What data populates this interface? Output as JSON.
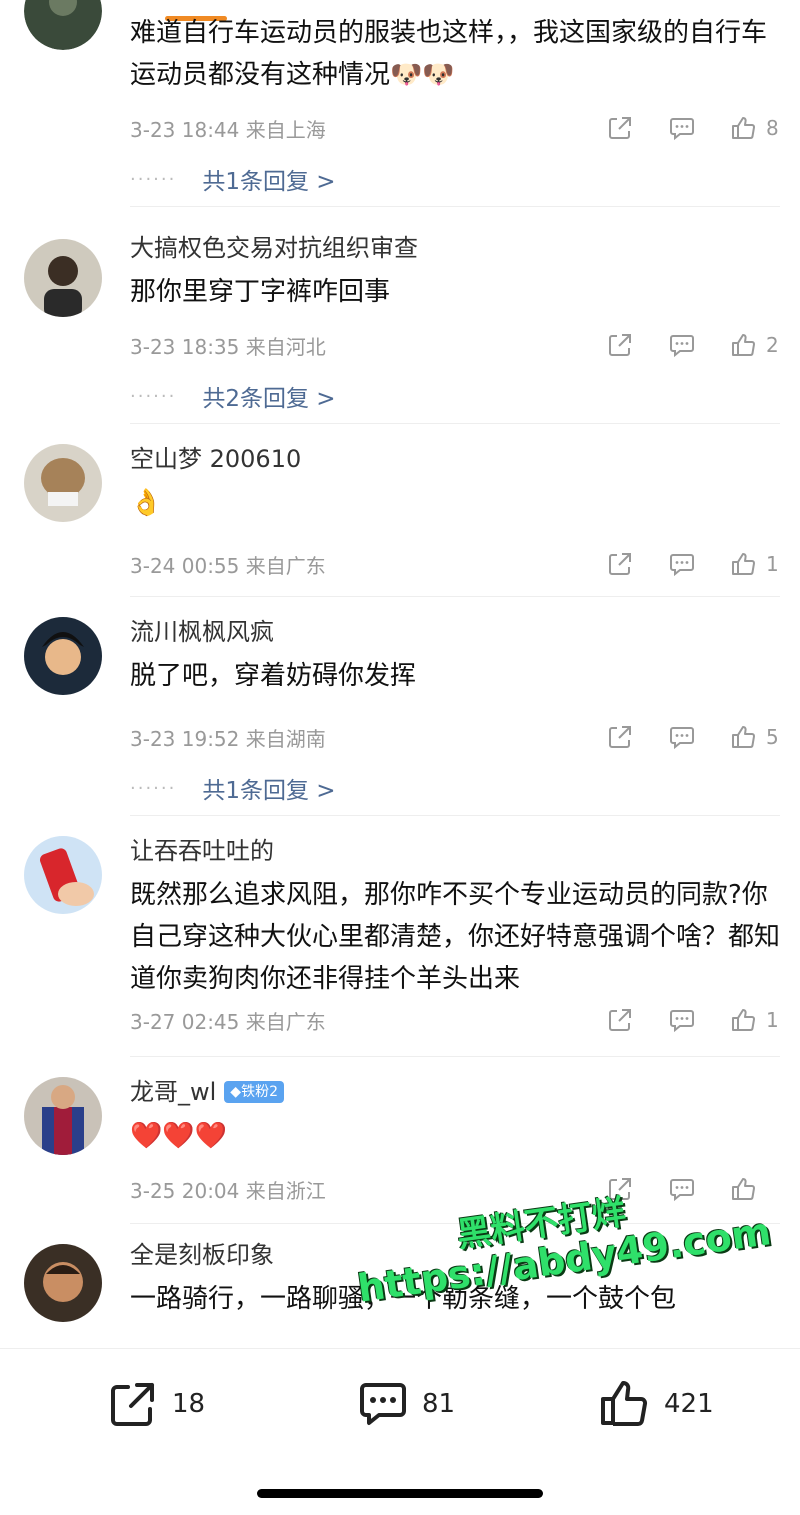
{
  "comments": [
    {
      "username": "",
      "content": "难道自行车运动员的服装也这样，，我这国家级的自行车运动员都没有这种情况🐶🐶",
      "time": "3-23 18:44 来自上海",
      "likes": "8",
      "replies": "共1条回复 >"
    },
    {
      "username": "大搞权色交易对抗组织审查",
      "content": "那你里穿丁字裤咋回事",
      "time": "3-23 18:35 来自河北",
      "likes": "2",
      "replies": "共2条回复 >"
    },
    {
      "username": "空山梦 200610",
      "content": "👌",
      "time": "3-24 00:55 来自广东",
      "likes": "1"
    },
    {
      "username": "流川枫枫风疯",
      "content": "脱了吧，穿着妨碍你发挥",
      "time": "3-23 19:52 来自湖南",
      "likes": "5",
      "replies": "共1条回复 >"
    },
    {
      "username": "让吞吞吐吐的",
      "content": "既然那么追求风阻，那你咋不买个专业运动员的同款?你自己穿这种大伙心里都清楚，你还好特意强调个啥？都知道你卖狗肉你还非得挂个羊头出来",
      "time": "3-27 02:45 来自广东",
      "likes": "1"
    },
    {
      "username": "龙哥_wl",
      "badge": "◆铁粉2",
      "content": "❤️❤️❤️",
      "time": "3-25 20:04 来自浙江",
      "likes": ""
    },
    {
      "username": "全是刻板印象",
      "content": "一路骑行，一路聊骚，一个勒条缝，一个鼓个包"
    }
  ],
  "bottom_bar": {
    "share_count": "18",
    "comment_count": "81",
    "like_count": "421"
  },
  "watermark": {
    "line1": "黑料不打烊",
    "line2": "https://abdy49.com"
  },
  "colors": {
    "link": "#4e6a93",
    "muted": "#999999",
    "accent": "#f08a24",
    "watermark": "#2fe06a"
  },
  "icons": [
    "share-icon",
    "comment-icon",
    "like-icon"
  ]
}
